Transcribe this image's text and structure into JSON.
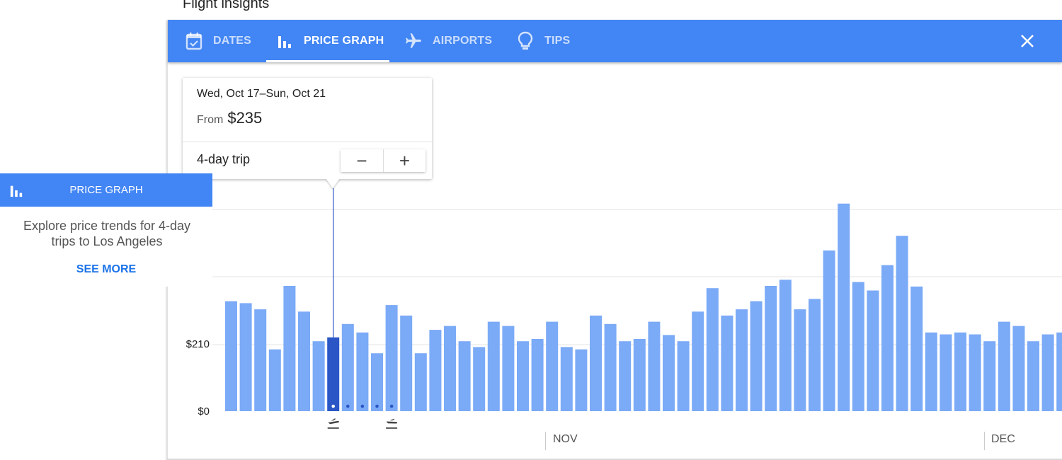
{
  "page": {
    "title": "Flight insights"
  },
  "toolbar": {
    "tabs": [
      {
        "label": "DATES",
        "icon": "calendar-check-icon"
      },
      {
        "label": "PRICE GRAPH",
        "icon": "bar-chart-icon",
        "active": true
      },
      {
        "label": "AIRPORTS",
        "icon": "airplane-icon"
      },
      {
        "label": "TIPS",
        "icon": "lightbulb-icon"
      }
    ],
    "close_icon": "close-icon"
  },
  "tooltip": {
    "dates": "Wed, Oct 17–Sun, Oct 21",
    "from_label": "From",
    "price": "$235",
    "trip_length": "4-day trip",
    "minus": "−",
    "plus": "+"
  },
  "promo": {
    "header": "PRICE GRAPH",
    "text": "Explore price trends for 4-day trips to Los Angeles",
    "link": "SEE MORE"
  },
  "colors": {
    "accent": "#4285f4",
    "bar": "#7baaf7",
    "selected_bar": "#2a56c6",
    "link": "#1a73e8"
  },
  "chart_data": {
    "type": "bar",
    "ytick_labels": [
      "$210",
      "$0"
    ],
    "y_ticks": [
      210,
      0
    ],
    "ylim": [
      0,
      620
    ],
    "month_labels": [
      "NOV",
      "DEC"
    ],
    "selected_index": 7,
    "return_index": 11,
    "values": [
      338,
      332,
      313,
      190,
      385,
      306,
      215,
      227,
      268,
      242,
      178,
      326,
      294,
      178,
      250,
      262,
      215,
      197,
      275,
      262,
      215,
      222,
      275,
      197,
      190,
      294,
      268,
      215,
      222,
      275,
      234,
      215,
      306,
      378,
      294,
      313,
      338,
      385,
      404,
      313,
      345,
      494,
      638,
      397,
      371,
      449,
      539,
      383,
      242,
      236,
      242,
      236,
      215,
      275,
      262,
      215,
      236,
      242
    ]
  }
}
